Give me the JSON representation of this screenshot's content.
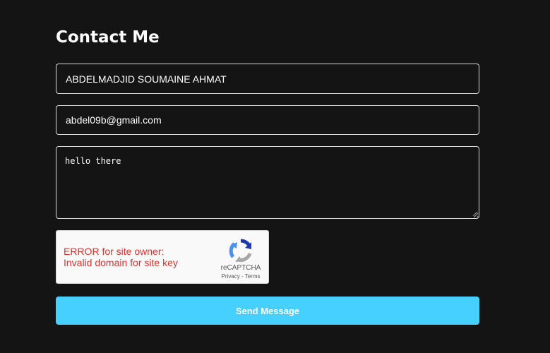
{
  "contact": {
    "title": "Contact Me",
    "name_value": "ABDELMADJID SOUMAINE AHMAT",
    "email_value": "abdel09b@gmail.com",
    "message_value": "hello there"
  },
  "recaptcha": {
    "error_line1": "ERROR for site owner:",
    "error_line2": "Invalid domain for site key",
    "brand": "reCAPTCHA",
    "privacy_label": "Privacy",
    "separator": " - ",
    "terms_label": "Terms",
    "logo_icon": "recaptcha-logo-icon",
    "error_color": "#e03131"
  },
  "form": {
    "send_label": "Send Message",
    "accent_color": "#45d0ff"
  }
}
